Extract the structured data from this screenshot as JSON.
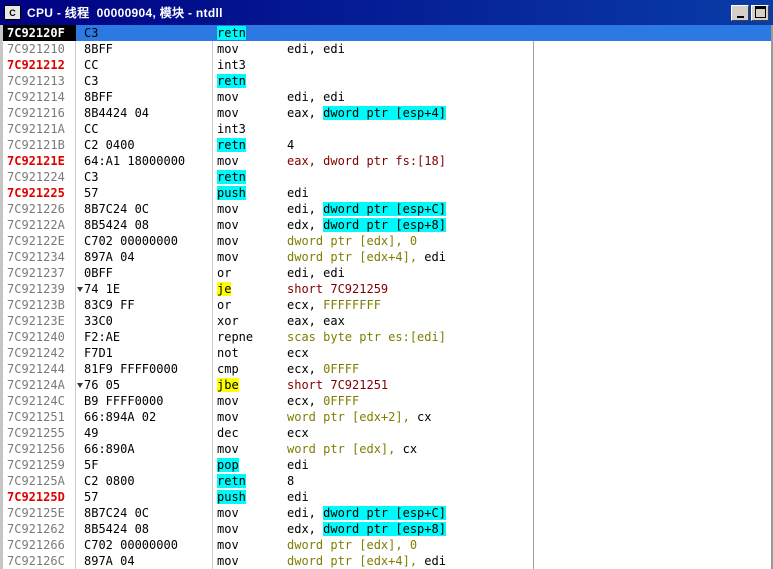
{
  "window": {
    "title": "CPU - 线程  00000904, 模块 - ntdll",
    "icon_letter": "C",
    "buttons": [
      "minimize-button",
      "maximize-button"
    ]
  },
  "colors": {
    "titlebar": "#000082",
    "selection_blue": "#2c79e4",
    "highlight_cyan": "#00fafa",
    "highlight_yellow": "#ffff00",
    "address_gray": "#7a7a7a",
    "address_red": "#e00000",
    "operand_olive": "#7e7e00",
    "operand_maroon": "#800000"
  },
  "disassembly": {
    "rows": [
      {
        "addr": "7C92120F",
        "addr_style": "eip",
        "selected": true,
        "bytes": "C3",
        "mnemonic": {
          "text": "retn",
          "hl": "cyan"
        },
        "operands": []
      },
      {
        "addr": "7C921210",
        "bytes": "8BFF",
        "mnemonic": {
          "text": "mov"
        },
        "operands": [
          {
            "t": "edi, edi"
          }
        ]
      },
      {
        "addr": "7C921212",
        "addr_style": "red",
        "bytes": "CC",
        "mnemonic": {
          "text": "int3"
        },
        "operands": []
      },
      {
        "addr": "7C921213",
        "bytes": "C3",
        "mnemonic": {
          "text": "retn",
          "hl": "cyan"
        },
        "operands": []
      },
      {
        "addr": "7C921214",
        "bytes": "8BFF",
        "mnemonic": {
          "text": "mov"
        },
        "operands": [
          {
            "t": "edi, edi"
          }
        ]
      },
      {
        "addr": "7C921216",
        "bytes": "8B4424 04",
        "mnemonic": {
          "text": "mov"
        },
        "operands": [
          {
            "t": "eax, "
          },
          {
            "t": "dword ptr [esp+4]",
            "hl": "cyan"
          }
        ]
      },
      {
        "addr": "7C92121A",
        "bytes": "CC",
        "mnemonic": {
          "text": "int3"
        },
        "operands": []
      },
      {
        "addr": "7C92121B",
        "bytes": "C2 0400",
        "mnemonic": {
          "text": "retn",
          "hl": "cyan"
        },
        "operands": [
          {
            "t": "4"
          }
        ]
      },
      {
        "addr": "7C92121E",
        "addr_style": "red",
        "bytes": "64:A1 18000000",
        "mnemonic": {
          "text": "mov"
        },
        "operands": [
          {
            "t": "eax, dword ptr fs:[18]",
            "c": "maroon"
          }
        ]
      },
      {
        "addr": "7C921224",
        "bytes": "C3",
        "mnemonic": {
          "text": "retn",
          "hl": "cyan"
        },
        "operands": []
      },
      {
        "addr": "7C921225",
        "addr_style": "red",
        "bytes": "57",
        "mnemonic": {
          "text": "push",
          "hl": "cyan"
        },
        "operands": [
          {
            "t": "edi"
          }
        ]
      },
      {
        "addr": "7C921226",
        "bytes": "8B7C24 0C",
        "mnemonic": {
          "text": "mov"
        },
        "operands": [
          {
            "t": "edi, "
          },
          {
            "t": "dword ptr [esp+C]",
            "hl": "cyan"
          }
        ]
      },
      {
        "addr": "7C92122A",
        "bytes": "8B5424 08",
        "mnemonic": {
          "text": "mov"
        },
        "operands": [
          {
            "t": "edx, "
          },
          {
            "t": "dword ptr [esp+8]",
            "hl": "cyan"
          }
        ]
      },
      {
        "addr": "7C92122E",
        "bytes": "C702 00000000",
        "mnemonic": {
          "text": "mov"
        },
        "operands": [
          {
            "t": "dword ptr [edx], 0",
            "c": "olive"
          }
        ]
      },
      {
        "addr": "7C921234",
        "bytes": "897A 04",
        "mnemonic": {
          "text": "mov"
        },
        "operands": [
          {
            "t": "dword ptr [edx+4], ",
            "c": "olive"
          },
          {
            "t": "edi"
          }
        ]
      },
      {
        "addr": "7C921237",
        "bytes": "0BFF",
        "mnemonic": {
          "text": "or"
        },
        "operands": [
          {
            "t": "edi, edi"
          }
        ]
      },
      {
        "addr": "7C921239",
        "jump_marker": true,
        "bytes": "74 1E",
        "mnemonic": {
          "text": "je",
          "hl": "yellow"
        },
        "operands": [
          {
            "t": "short 7C921259",
            "c": "maroon"
          }
        ]
      },
      {
        "addr": "7C92123B",
        "bytes": "83C9 FF",
        "mnemonic": {
          "text": "or"
        },
        "operands": [
          {
            "t": "ecx, "
          },
          {
            "t": "FFFFFFFF",
            "c": "olive"
          }
        ]
      },
      {
        "addr": "7C92123E",
        "bytes": "33C0",
        "mnemonic": {
          "text": "xor"
        },
        "operands": [
          {
            "t": "eax, eax"
          }
        ]
      },
      {
        "addr": "7C921240",
        "bytes": "F2:AE",
        "mnemonic": {
          "text": "repne"
        },
        "operands": [
          {
            "t": "scas byte ptr es:[edi]",
            "c": "olive"
          }
        ]
      },
      {
        "addr": "7C921242",
        "bytes": "F7D1",
        "mnemonic": {
          "text": "not"
        },
        "operands": [
          {
            "t": "ecx"
          }
        ]
      },
      {
        "addr": "7C921244",
        "bytes": "81F9 FFFF0000",
        "mnemonic": {
          "text": "cmp"
        },
        "operands": [
          {
            "t": "ecx, "
          },
          {
            "t": "0FFFF",
            "c": "olive"
          }
        ]
      },
      {
        "addr": "7C92124A",
        "jump_marker": true,
        "bytes": "76 05",
        "mnemonic": {
          "text": "jbe",
          "hl": "yellow"
        },
        "operands": [
          {
            "t": "short 7C921251",
            "c": "maroon"
          }
        ]
      },
      {
        "addr": "7C92124C",
        "bytes": "B9 FFFF0000",
        "mnemonic": {
          "text": "mov"
        },
        "operands": [
          {
            "t": "ecx, "
          },
          {
            "t": "0FFFF",
            "c": "olive"
          }
        ]
      },
      {
        "addr": "7C921251",
        "bytes": "66:894A 02",
        "mnemonic": {
          "text": "mov"
        },
        "operands": [
          {
            "t": "word ptr [edx+2], ",
            "c": "olive"
          },
          {
            "t": "cx"
          }
        ]
      },
      {
        "addr": "7C921255",
        "bytes": "49",
        "mnemonic": {
          "text": "dec"
        },
        "operands": [
          {
            "t": "ecx"
          }
        ]
      },
      {
        "addr": "7C921256",
        "bytes": "66:890A",
        "mnemonic": {
          "text": "mov"
        },
        "operands": [
          {
            "t": "word ptr [edx], ",
            "c": "olive"
          },
          {
            "t": "cx"
          }
        ]
      },
      {
        "addr": "7C921259",
        "bytes": "5F",
        "mnemonic": {
          "text": "pop",
          "hl": "cyan"
        },
        "operands": [
          {
            "t": "edi"
          }
        ]
      },
      {
        "addr": "7C92125A",
        "bytes": "C2 0800",
        "mnemonic": {
          "text": "retn",
          "hl": "cyan"
        },
        "operands": [
          {
            "t": "8"
          }
        ]
      },
      {
        "addr": "7C92125D",
        "addr_style": "red",
        "bytes": "57",
        "mnemonic": {
          "text": "push",
          "hl": "cyan"
        },
        "operands": [
          {
            "t": "edi"
          }
        ]
      },
      {
        "addr": "7C92125E",
        "bytes": "8B7C24 0C",
        "mnemonic": {
          "text": "mov"
        },
        "operands": [
          {
            "t": "edi, "
          },
          {
            "t": "dword ptr [esp+C]",
            "hl": "cyan"
          }
        ]
      },
      {
        "addr": "7C921262",
        "bytes": "8B5424 08",
        "mnemonic": {
          "text": "mov"
        },
        "operands": [
          {
            "t": "edx, "
          },
          {
            "t": "dword ptr [esp+8]",
            "hl": "cyan"
          }
        ]
      },
      {
        "addr": "7C921266",
        "bytes": "C702 00000000",
        "mnemonic": {
          "text": "mov"
        },
        "operands": [
          {
            "t": "dword ptr [edx], 0",
            "c": "olive"
          }
        ]
      },
      {
        "addr": "7C92126C",
        "bytes": "897A 04",
        "mnemonic": {
          "text": "mov"
        },
        "operands": [
          {
            "t": "dword ptr [edx+4], ",
            "c": "olive"
          },
          {
            "t": "edi"
          }
        ]
      }
    ]
  }
}
